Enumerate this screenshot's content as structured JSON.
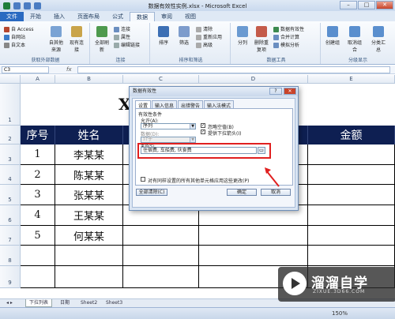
{
  "window": {
    "title": "数据有效性实例.xlsx - Microsoft Excel",
    "min": "–",
    "max": "□",
    "close": "✕"
  },
  "ribbon_tabs": [
    "文件",
    "开始",
    "插入",
    "页面布局",
    "公式",
    "数据",
    "审阅",
    "视图"
  ],
  "ribbon": {
    "groups": [
      {
        "label": "获取外部数据",
        "small": [
          "自 Access",
          "自网站",
          "自文本"
        ],
        "big": [
          "自其他来源",
          "现有连接"
        ]
      },
      {
        "label": "连接",
        "big": [
          "全部刷新"
        ],
        "small": [
          "连接",
          "属性",
          "编辑链接"
        ]
      },
      {
        "label": "排序和筛选",
        "big": [
          "排序",
          "筛选"
        ],
        "small": [
          "清除",
          "重新应用",
          "高级"
        ]
      },
      {
        "label": "数据工具",
        "big": [
          "分列",
          "删除重复项"
        ],
        "small": [
          "数据有效性",
          "合并计算",
          "模拟分析"
        ]
      },
      {
        "label": "分级显示",
        "big": [
          "创建组",
          "取消组合",
          "分类汇总"
        ]
      }
    ]
  },
  "formula_bar": {
    "name_box": "C3",
    "fx": "fx",
    "value": ""
  },
  "columns": [
    "A",
    "B",
    "C",
    "D",
    "E"
  ],
  "rows": [
    "1",
    "2",
    "3",
    "4",
    "5",
    "6",
    "7",
    "8",
    "9"
  ],
  "sheet": {
    "title_fragment": "X",
    "headers": [
      "序号",
      "姓名",
      "金额"
    ],
    "data": [
      {
        "num": "1",
        "name": "李某某"
      },
      {
        "num": "2",
        "name": "陈某某"
      },
      {
        "num": "3",
        "name": "张某某"
      },
      {
        "num": "4",
        "name": "王某某"
      },
      {
        "num": "5",
        "name": "何某某"
      }
    ]
  },
  "sheet_tabs": [
    "下拉列表",
    "日期",
    "Sheet2",
    "Sheet3"
  ],
  "status": {
    "zoom": "150%"
  },
  "dialog": {
    "title": "数据有效性",
    "help": "?",
    "close": "✕",
    "tabs": [
      "设置",
      "输入信息",
      "出错警告",
      "输入法模式"
    ],
    "section": "有效性条件",
    "allow_label": "允许(A):",
    "allow_value": "序列",
    "ignore_blank": "忽略空值(B)",
    "dropdown": "提供下拉箭头(I)",
    "data_label": "数据(D):",
    "data_value": "介于",
    "source_label": "来源(S):",
    "source_value": "住宿费, 车船费, 伙食费",
    "apply_all": "对有同样设置的所有其他单元格应用这些更改(P)",
    "clear_all": "全部清除(C)",
    "ok": "确定",
    "cancel": "取消"
  },
  "watermark": {
    "main": "溜溜自学",
    "sub": "ZIXUE.3D66.COM"
  },
  "colors": {
    "header_bg": "#0e1f52",
    "highlight": "#e02020",
    "file_tab": "#2a6ac1"
  }
}
